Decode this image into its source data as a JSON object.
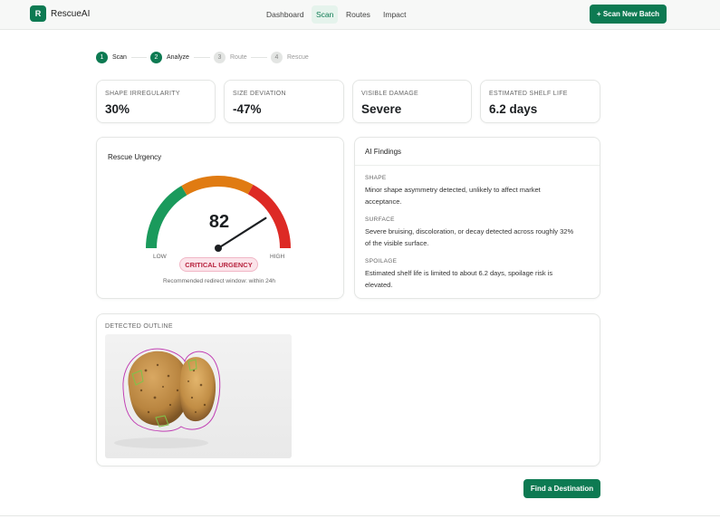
{
  "app": {
    "logo_letter": "R",
    "brand": "RescueAI"
  },
  "nav": {
    "items": [
      {
        "label": "Dashboard"
      },
      {
        "label": "Scan",
        "active": true
      },
      {
        "label": "Routes"
      },
      {
        "label": "Impact"
      }
    ],
    "cta_label": "+ Scan New Batch"
  },
  "steps": [
    {
      "number": "1",
      "label": "Scan",
      "state": "done"
    },
    {
      "number": "2",
      "label": "Analyze",
      "state": "done"
    },
    {
      "number": "3",
      "label": "Route",
      "state": "todo"
    },
    {
      "number": "4",
      "label": "Rescue",
      "state": "todo"
    }
  ],
  "metrics": [
    {
      "label": "SHAPE IRREGULARITY",
      "value": "30%"
    },
    {
      "label": "SIZE DEVIATION",
      "value": "-47%"
    },
    {
      "label": "VISIBLE DAMAGE",
      "value": "Severe"
    },
    {
      "label": "ESTIMATED SHELF LIFE",
      "value": "6.2 days"
    }
  ],
  "urgency": {
    "title": "Rescue Urgency",
    "score": "82",
    "score_fraction": 0.82,
    "low_label": "LOW",
    "high_label": "HIGH",
    "badge": "CRITICAL URGENCY",
    "note": "Recommended redirect window: within 24h",
    "colors": {
      "green": "#1a9a5c",
      "orange": "#e07b12",
      "red": "#dd2a25"
    }
  },
  "findings": {
    "title": "AI Findings",
    "items": [
      {
        "label": "SHAPE",
        "line1": "Minor shape asymmetry detected, unlikely to affect market",
        "line2": "acceptance."
      },
      {
        "label": "SURFACE",
        "line1": "Severe bruising, discoloration, or decay detected across roughly 32%",
        "line2": "of the visible surface."
      },
      {
        "label": "SPOILAGE",
        "line1": "Estimated shelf life is limited to about 6.2 days, spoilage risk is",
        "line2": "elevated."
      }
    ]
  },
  "outline": {
    "title": "DETECTED OUTLINE",
    "image_icon": "potato-photo-icon"
  },
  "actions": {
    "find_destination": "Find a Destination"
  },
  "theme": {
    "accent": "#0d7a52",
    "badge_red": "#b8243f"
  }
}
